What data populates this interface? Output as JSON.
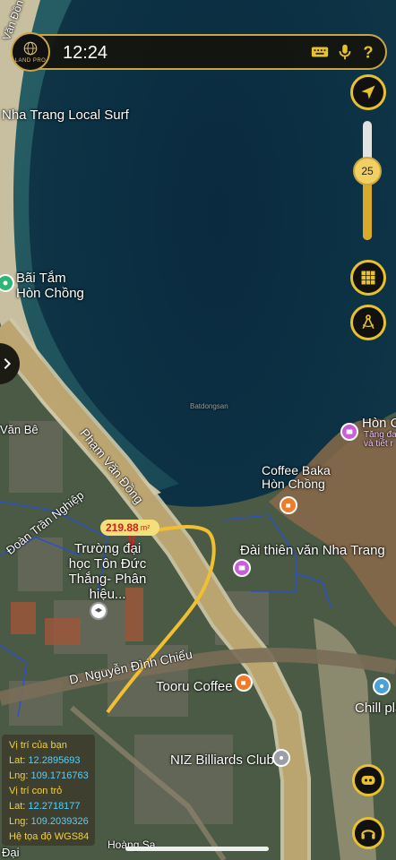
{
  "status": {
    "time": "12:24"
  },
  "app": {
    "logo_text": "LAND PRO"
  },
  "icons": [
    "keyboard-icon",
    "microphone-icon",
    "help-icon",
    "locate-icon",
    "grid-icon",
    "compass-measure-icon",
    "chevron-right-icon",
    "chat-bot-icon",
    "headset-icon",
    "location-pin-icon"
  ],
  "zoom": {
    "level": "25",
    "fraction": 0.58
  },
  "map_labels": {
    "top_road": "Văn Đồn",
    "surf": "Nha Trang Local Surf",
    "beach": "Bãi Tắm Hòn Chồng",
    "island": "Hòn C",
    "island_sub1": "Tặng đa",
    "island_sub2": "và tiết r",
    "coffee_baka": "Coffee Baka Hòn Chồng",
    "van_be": "Văn Bê",
    "pham_van_dong": "Phạm Văn Đồng",
    "doan_tran_nghiep": "Đoàn Trần Nghiệp",
    "school": "Trường đại học Tôn Đức Thắng- Phân hiệu...",
    "observatory": "Đài thiên văn Nha Trang",
    "nguyen_dinh_chieu": "D. Nguyễn Đình Chiểu",
    "tooru": "Tooru Coffee",
    "chill": "Chill pla",
    "niz": "NIZ Billiards Club",
    "bottom_road": "Hoàng Sa",
    "bottom_left": "Đại",
    "watermark": "Batdongsan"
  },
  "measurement": {
    "value": "219.88",
    "unit": "m²"
  },
  "info_panel": {
    "your_location": "Vị trí của bạn",
    "lat1_label": "Lat:",
    "lat1": "12.2895693",
    "lng1_label": "Lng:",
    "lng1": "109.1716763",
    "pointer_location": "Vị trí con trỏ",
    "lat2_label": "Lat:",
    "lat2": "12.2718177",
    "lng2_label": "Lng:",
    "lng2": "109.2039326",
    "crs": "Hệ tọa độ WGS84"
  },
  "colors": {
    "gold": "#e8c12e",
    "route": "#f0c030",
    "parcel": "#2a4fd0",
    "sea": "#0d2a3a"
  }
}
